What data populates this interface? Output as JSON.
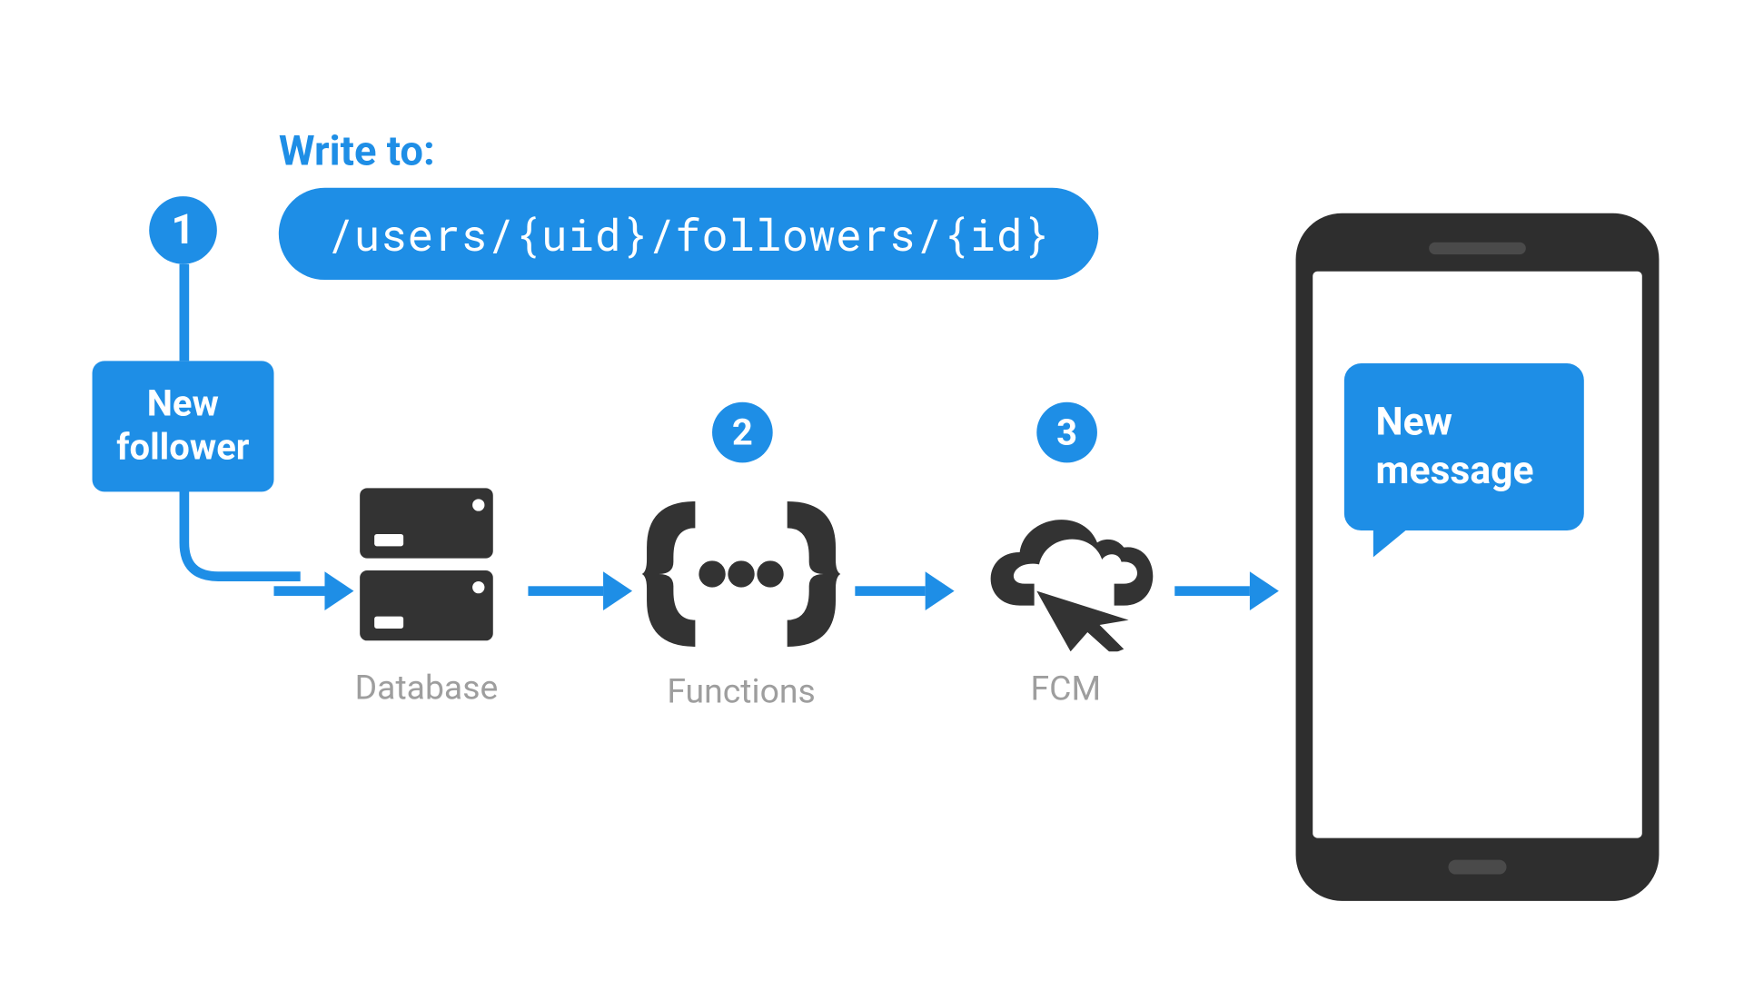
{
  "header": {
    "write_label": "Write to:",
    "path": "/users/{uid}/followers/{id}"
  },
  "steps": {
    "one": "1",
    "two": "2",
    "three": "3"
  },
  "trigger": {
    "new_follower_line1": "New",
    "new_follower_line2": "follower"
  },
  "nodes": {
    "database_label": "Database",
    "functions_label": "Functions",
    "fcm_label": "FCM"
  },
  "phone": {
    "bubble_line1": "New",
    "bubble_line2": "message"
  },
  "colors": {
    "primary": "#1E8EE6",
    "icon": "#333333",
    "label": "#9E9E9E"
  }
}
